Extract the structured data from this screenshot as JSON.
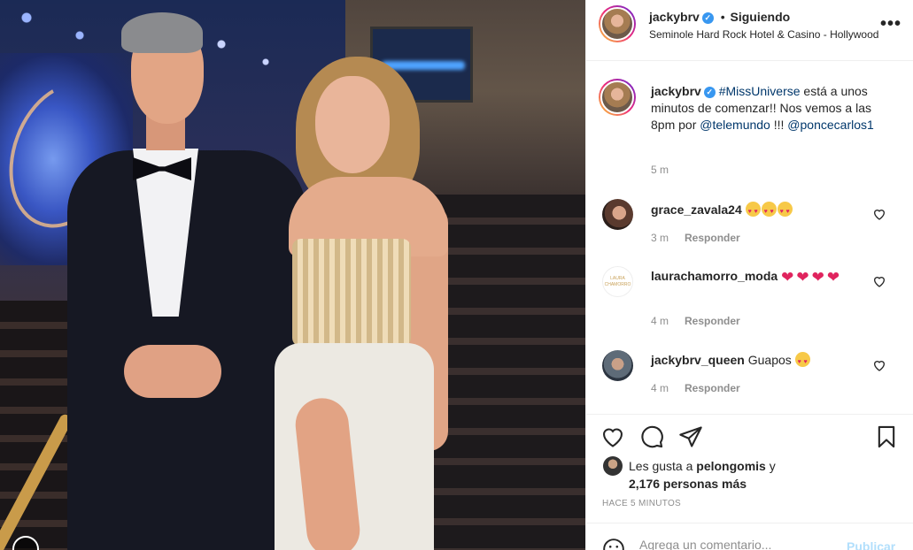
{
  "post": {
    "username": "jackybrv",
    "verified_mark": "✓",
    "separator": "•",
    "follow_status": "Siguiendo",
    "location": "Seminole Hard Rock Hotel & Casino - Hollywood",
    "options_label": "•••"
  },
  "caption": {
    "username": "jackybrv",
    "hashtag": "#MissUniverse",
    "text_1": " está a unos minutos de comenzar!! Nos vemos a las 8pm por ",
    "mention_1": "@telemundo",
    "text_2": " !!! ",
    "mention_2": "@poncecarlos1",
    "time": "5 m"
  },
  "comments": [
    {
      "username": "grace_zavala24",
      "text": "",
      "emoji": "heart-eyes-x3",
      "time": "3 m",
      "reply": "Responder"
    },
    {
      "username": "laurachamorro_moda",
      "text": "",
      "emoji": "red-hearts-x4",
      "time": "4 m",
      "reply": "Responder",
      "avatar_text": "LAURA CHAMORRO"
    },
    {
      "username": "jackybrv_queen",
      "text": "Guapos",
      "emoji": "heart-eyes-x1",
      "time": "4 m",
      "reply": "Responder"
    }
  ],
  "likes": {
    "prefix": "Les gusta a ",
    "liker": "pelongomis",
    "connector": " y ",
    "others": "2,176 personas más"
  },
  "posted_ago": "HACE 5 MINUTOS",
  "comment_input": {
    "placeholder": "Agrega un comentario...",
    "publish_label": "Publicar"
  },
  "colors": {
    "link": "#00376b",
    "verified": "#3897f0",
    "muted": "#8e8e8e",
    "publish_disabled": "#b2dffc"
  }
}
